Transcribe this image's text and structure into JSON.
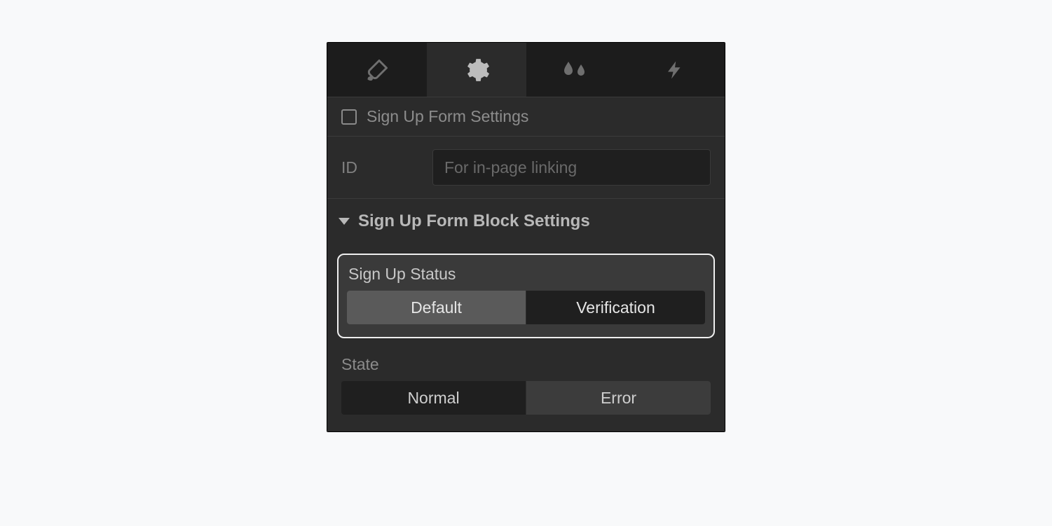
{
  "tabs": {
    "items": [
      "brush",
      "settings",
      "effects",
      "bolt"
    ],
    "active_index": 1
  },
  "section_title": "Sign Up Form Settings",
  "id_row": {
    "label": "ID",
    "placeholder": "For in-page linking",
    "value": ""
  },
  "block_header": "Sign Up Form Block Settings",
  "signup_status": {
    "label": "Sign Up Status",
    "options": [
      "Default",
      "Verification"
    ],
    "selected_index": 0
  },
  "state": {
    "label": "State",
    "options": [
      "Normal",
      "Error"
    ],
    "selected_index": 1
  }
}
